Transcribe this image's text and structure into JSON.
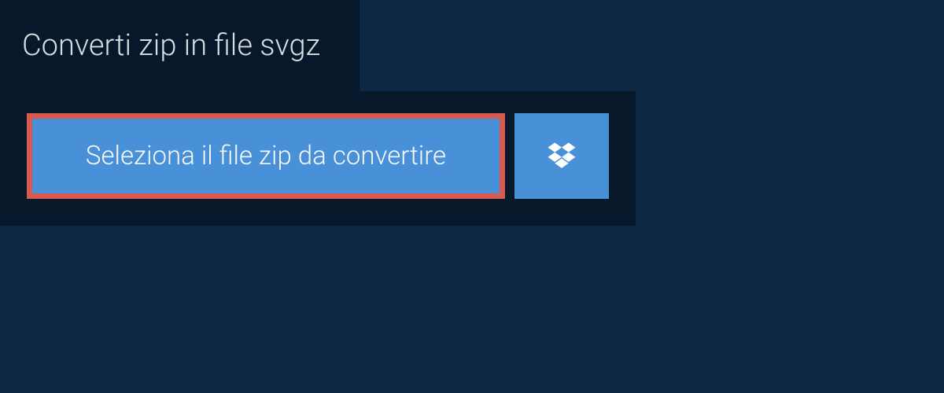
{
  "tab": {
    "title": "Converti zip in file svgz"
  },
  "upload": {
    "select_file_label": "Seleziona il file zip da convertire"
  }
}
